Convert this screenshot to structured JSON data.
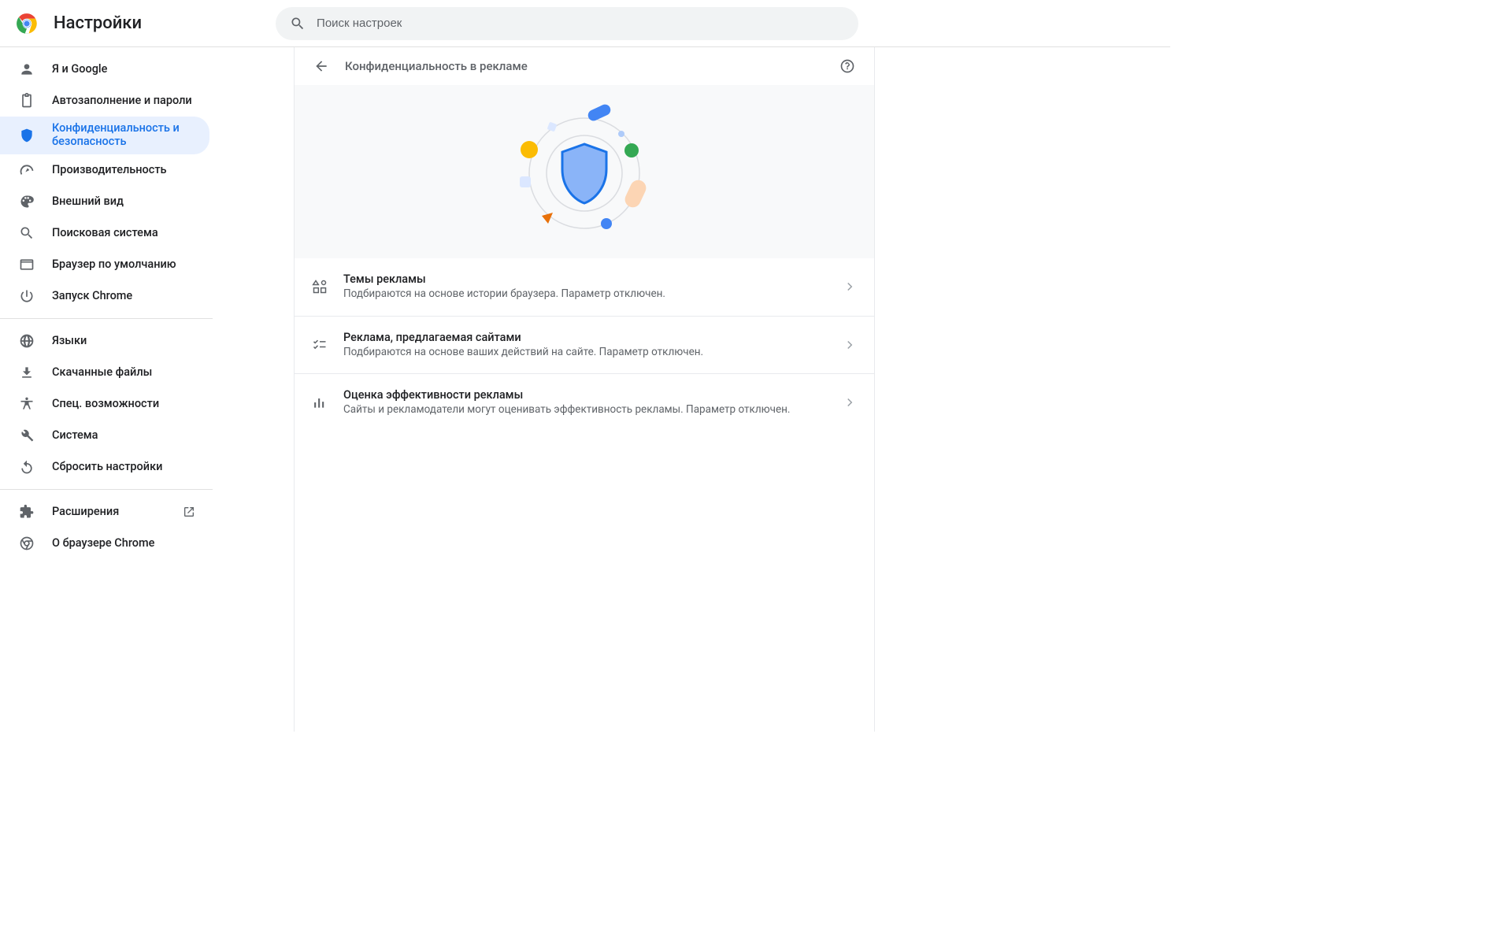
{
  "app_title": "Настройки",
  "search": {
    "placeholder": "Поиск настроек"
  },
  "sidebar": {
    "items": [
      {
        "id": "you-google",
        "label": "Я и Google"
      },
      {
        "id": "autofill",
        "label": "Автозаполнение и пароли"
      },
      {
        "id": "privacy",
        "label": "Конфиденциальность и безопасность",
        "active": true
      },
      {
        "id": "performance",
        "label": "Производительность"
      },
      {
        "id": "appearance",
        "label": "Внешний вид"
      },
      {
        "id": "search-engine",
        "label": "Поисковая система"
      },
      {
        "id": "default-browser",
        "label": "Браузер по умолчанию"
      },
      {
        "id": "on-startup",
        "label": "Запуск Chrome"
      },
      {
        "id": "languages",
        "label": "Языки"
      },
      {
        "id": "downloads",
        "label": "Скачанные файлы"
      },
      {
        "id": "accessibility",
        "label": "Спец. возможности"
      },
      {
        "id": "system",
        "label": "Система"
      },
      {
        "id": "reset",
        "label": "Сбросить настройки"
      },
      {
        "id": "extensions",
        "label": "Расширения"
      },
      {
        "id": "about",
        "label": "О браузере Chrome"
      }
    ]
  },
  "page": {
    "title": "Конфиденциальность в рекламе",
    "rows": [
      {
        "id": "ad-topics",
        "title": "Темы рекламы",
        "sub": "Подбираются на основе истории браузера. Параметр отключен."
      },
      {
        "id": "site-ads",
        "title": "Реклама, предлагаемая сайтами",
        "sub": "Подбираются на основе ваших действий на сайте. Параметр отключен."
      },
      {
        "id": "ad-measurement",
        "title": "Оценка эффективности рекламы",
        "sub": "Сайты и рекламодатели могут оценивать эффективность рекламы. Параметр отключен."
      }
    ]
  }
}
